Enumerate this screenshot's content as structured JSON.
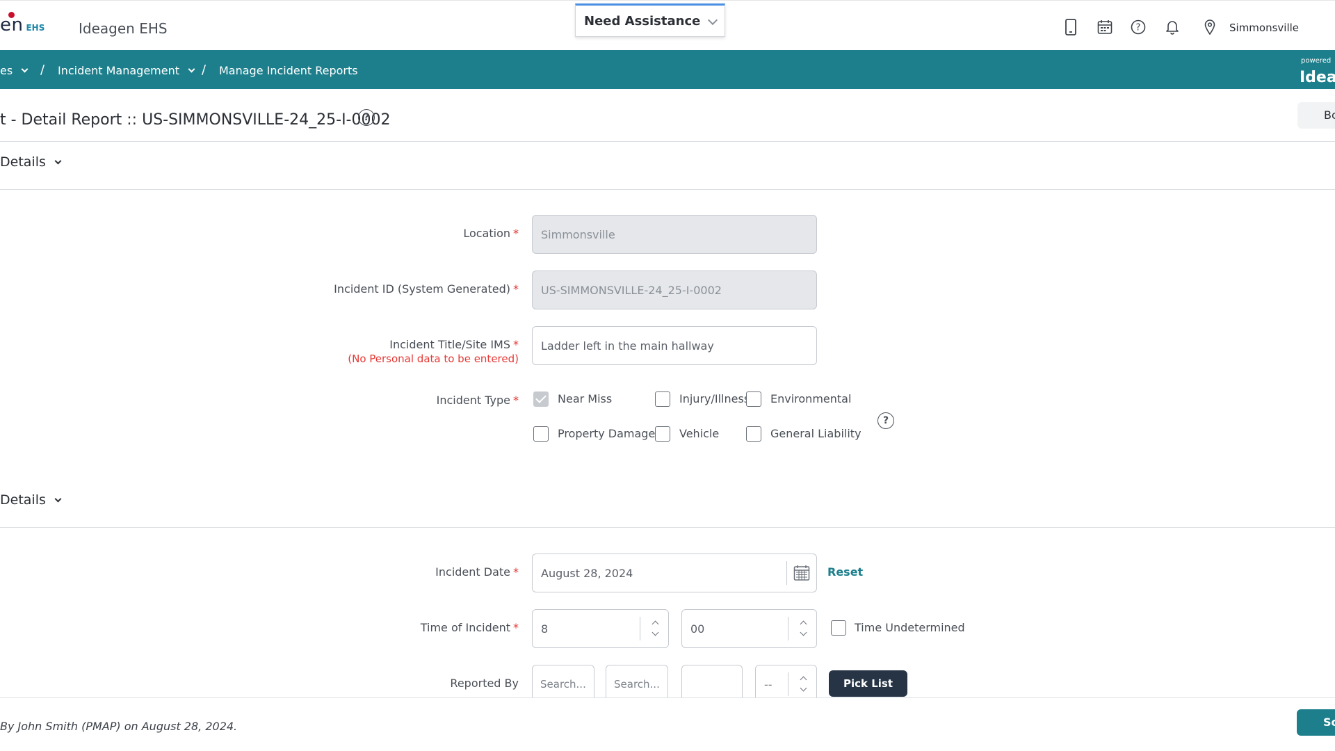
{
  "header": {
    "logo_text": "en",
    "logo_suffix": "EHS",
    "app_title": "Ideagen EHS",
    "assist_label": "Need Assistance",
    "site_name": "Simmonsville"
  },
  "breadcrumbs": {
    "item1": "es",
    "sep1": "/",
    "item2": "Incident Management",
    "sep2": "/",
    "item3": "Manage Incident Reports",
    "powered_by": "powered",
    "powered_brand": "Ideag"
  },
  "page": {
    "title": "t - Detail Report :: US-SIMMONSVILLE-24_25-I-0002",
    "help": "?",
    "back_label": "Bc"
  },
  "section1": {
    "title": "Details",
    "location_label": "Location",
    "location_value": "Simmonsville",
    "incident_id_label": "Incident ID (System Generated)",
    "incident_id_value": "US-SIMMONSVILLE-24_25-I-0002",
    "title_label": "Incident Title/Site IMS",
    "title_note": "(No Personal data to be entered)",
    "title_value": "Ladder left in the main hallway",
    "type_label": "Incident Type",
    "types": {
      "near_miss": "Near Miss",
      "injury": "Injury/Illness",
      "environmental": "Environmental",
      "property_damage": "Property Damage",
      "vehicle": "Vehicle",
      "general_liability": "General Liability"
    },
    "type_help": "?",
    "required_mark": "*"
  },
  "section2": {
    "title": "Details",
    "date_label": "Incident Date",
    "date_value": "August 28, 2024",
    "reset_label": "Reset",
    "time_label": "Time of Incident",
    "time_hour": "8",
    "time_minute": "00",
    "time_undetermined": "Time Undetermined",
    "reported_by_label": "Reported By",
    "search_placeholder_1": "Search...",
    "search_placeholder_2": "Search...",
    "reported_field_3": "",
    "reported_select": "--",
    "picklist_label": "Pick List"
  },
  "footer": {
    "audit_text": "By John Smith (PMAP) on August 28, 2024.",
    "save_label": "Sc"
  },
  "colors": {
    "brand_teal": "#1d7f8c",
    "required_red": "#e53935",
    "picklist_dark": "#263445"
  }
}
